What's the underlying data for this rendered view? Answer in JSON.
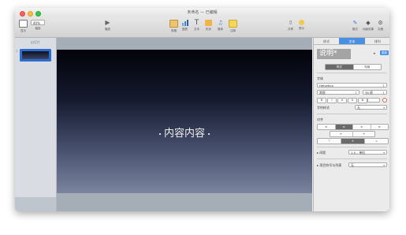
{
  "window": {
    "title": "未命名 — 已编辑"
  },
  "toolbar": {
    "view_label": "显示",
    "zoom_value": "40%",
    "zoom_label": "缩放",
    "play_label": "播放",
    "items": [
      {
        "label": "表格",
        "icon": "table-icon"
      },
      {
        "label": "图表",
        "icon": "chart-icon"
      },
      {
        "label": "文本",
        "icon": "text-icon"
      },
      {
        "label": "形状",
        "icon": "shape-icon"
      },
      {
        "label": "媒体",
        "icon": "media-icon"
      },
      {
        "label": "注释",
        "icon": "comment-icon"
      }
    ],
    "share_label": "共享",
    "tips_label": "提示",
    "format_label": "格式",
    "animate_label": "动画效果",
    "document_label": "文稿"
  },
  "navigator": {
    "header": "幻灯片",
    "slide_number": "1"
  },
  "slide": {
    "text": "内容内容"
  },
  "inspector": {
    "tabs": [
      "样式",
      "文本",
      "排列"
    ],
    "active_tab": "文本",
    "style_preview": "说明*",
    "update_label": "更新",
    "style_tabs": [
      "样式",
      "布局"
    ],
    "font_section": "字体",
    "font_family": "Helvetica",
    "font_style": "常规",
    "font_size": "36 磅",
    "format_buttons": [
      "B",
      "I",
      "U",
      "S",
      "⚙"
    ],
    "char_style_label": "字符样式",
    "char_style_value": "无",
    "alignment_label": "对齐",
    "spacing_label": "间距",
    "spacing_value": "1.0 – 单倍",
    "bullets_label": "项目符号与列表",
    "bullets_value": "无"
  }
}
